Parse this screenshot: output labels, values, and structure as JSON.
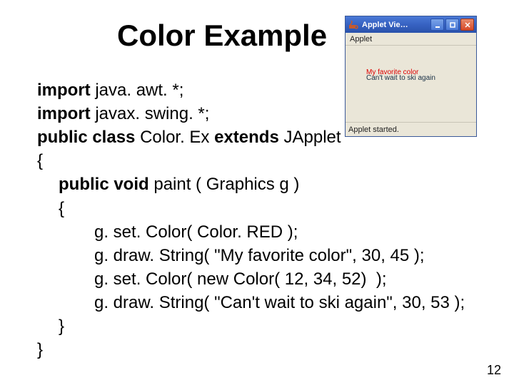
{
  "title": "Color Example",
  "page_number": "12",
  "applet": {
    "window_title": "Applet Vie…",
    "menu_label": "Applet",
    "fav_text": "My favorite color",
    "ski_text": "Can't wait to ski again",
    "status": "Applet started."
  },
  "code": {
    "l1a": "import",
    "l1b": " java. awt. *;",
    "l2a": "import",
    "l2b": " javax. swing. *;",
    "l3a": "public class ",
    "l3b": "Color. Ex ",
    "l3c": "extends ",
    "l3d": "JApplet",
    "l4": "{",
    "l5a": "public void ",
    "l5b": "paint ( Graphics g )",
    "l6": "{",
    "l7": "g. set. Color( Color. RED );",
    "l8": "g. draw. String( \"My favorite color\", 30, 45 );",
    "l9": "g. set. Color( new Color( 12, 34, 52)  );",
    "l10": "g. draw. String( \"Can't wait to ski again\", 30, 53 );",
    "l11": "}",
    "l12": "}"
  }
}
